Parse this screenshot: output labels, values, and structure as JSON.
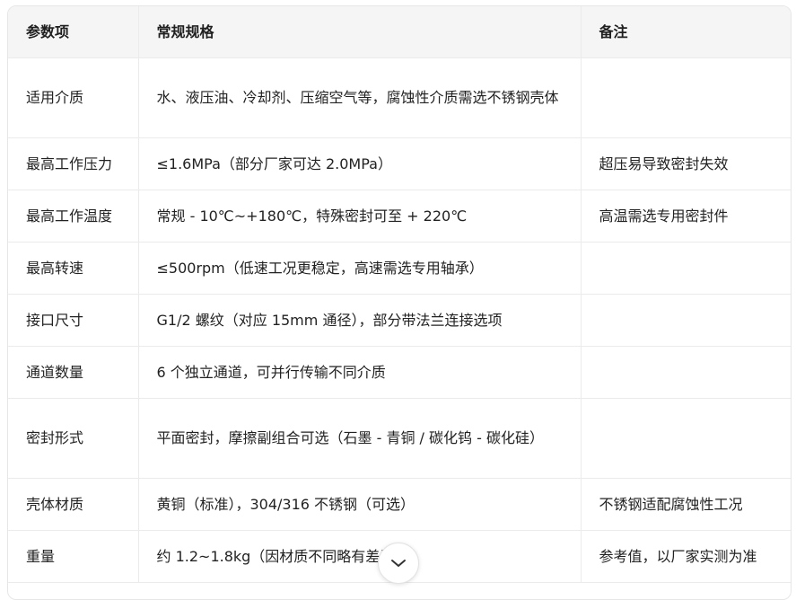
{
  "table": {
    "headers": [
      "参数项",
      "常规规格",
      "备注"
    ],
    "rows": [
      {
        "param": "适用介质",
        "spec": "水、液压油、冷却剂、压缩空气等，腐蚀性介质需选不锈钢壳体",
        "note": ""
      },
      {
        "param": "最高工作压力",
        "spec": "≤1.6MPa（部分厂家可达 2.0MPa）",
        "note": "超压易导致密封失效"
      },
      {
        "param": "最高工作温度",
        "spec": "常规 - 10℃~+180℃，特殊密封可至 + 220℃",
        "note": "高温需选专用密封件"
      },
      {
        "param": "最高转速",
        "spec": "≤500rpm（低速工况更稳定，高速需选专用轴承）",
        "note": ""
      },
      {
        "param": "接口尺寸",
        "spec": "G1/2 螺纹（对应 15mm 通径），部分带法兰连接选项",
        "note": ""
      },
      {
        "param": "通道数量",
        "spec": "6 个独立通道，可并行传输不同介质",
        "note": ""
      },
      {
        "param": "密封形式",
        "spec": "平面密封，摩擦副组合可选（石墨 - 青铜 / 碳化钨 - 碳化硅）",
        "note": ""
      },
      {
        "param": "壳体材质",
        "spec": "黄铜（标准），304/316 不锈钢（可选）",
        "note": "不锈钢适配腐蚀性工况"
      },
      {
        "param": "重量",
        "spec": "约 1.2~1.8kg（因材质不同略有差异）",
        "note": "参考值，以厂家实测为准"
      }
    ]
  },
  "scroll_button": {
    "icon": "chevron-down-icon"
  }
}
